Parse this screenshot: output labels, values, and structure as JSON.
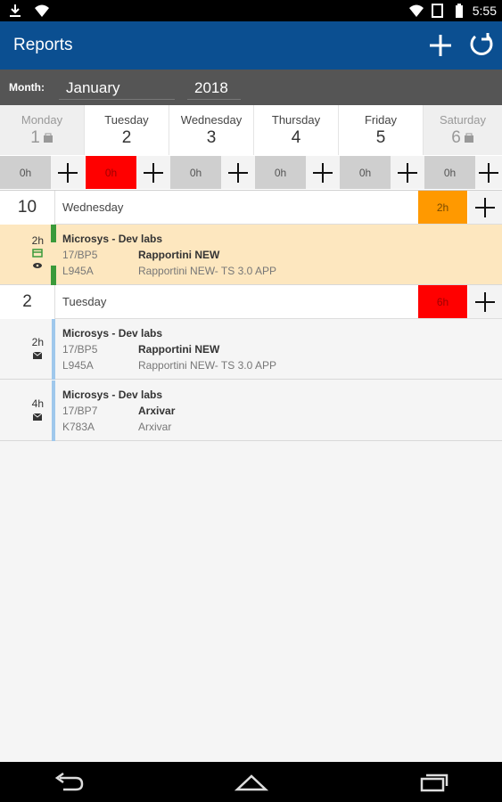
{
  "status": {
    "time": "5:55"
  },
  "app": {
    "title": "Reports"
  },
  "filter": {
    "month_label": "Month:",
    "month": "January",
    "year": "2018"
  },
  "week": [
    {
      "name": "Monday",
      "date": "1",
      "weekend": true
    },
    {
      "name": "Tuesday",
      "date": "2",
      "weekend": false
    },
    {
      "name": "Wednesday",
      "date": "3",
      "weekend": false
    },
    {
      "name": "Thursday",
      "date": "4",
      "weekend": false
    },
    {
      "name": "Friday",
      "date": "5",
      "weekend": false
    },
    {
      "name": "Saturday",
      "date": "6",
      "weekend": true
    }
  ],
  "hours": [
    "0h",
    "0h",
    "0h",
    "0h",
    "0h",
    "0h"
  ],
  "groups": [
    {
      "day_number": "10",
      "day_name": "Wednesday",
      "total": "2h",
      "total_color": "#ff9900",
      "entries": [
        {
          "duration": "2h",
          "client": "Microsys - Dev labs",
          "code": "17/BP5",
          "project": "Rapportini NEW",
          "ref": "L945A",
          "detail": "Rapportini NEW- TS 3.0 APP",
          "bg": "#fde7bf",
          "bar": "#3a9a3a"
        }
      ]
    },
    {
      "day_number": "2",
      "day_name": "Tuesday",
      "total": "6h",
      "total_color": "#ff0000",
      "entries": [
        {
          "duration": "2h",
          "client": "Microsys - Dev labs",
          "code": "17/BP5",
          "project": "Rapportini NEW",
          "ref": "L945A",
          "detail": "Rapportini NEW- TS 3.0 APP",
          "bg": "#f5f5f5",
          "bar": "#9fc8ec"
        },
        {
          "duration": "4h",
          "client": "Microsys - Dev labs",
          "code": "17/BP7",
          "project": "Arxivar",
          "ref": "K783A",
          "detail": "Arxivar",
          "bg": "#f5f5f5",
          "bar": "#9fc8ec"
        }
      ]
    }
  ]
}
